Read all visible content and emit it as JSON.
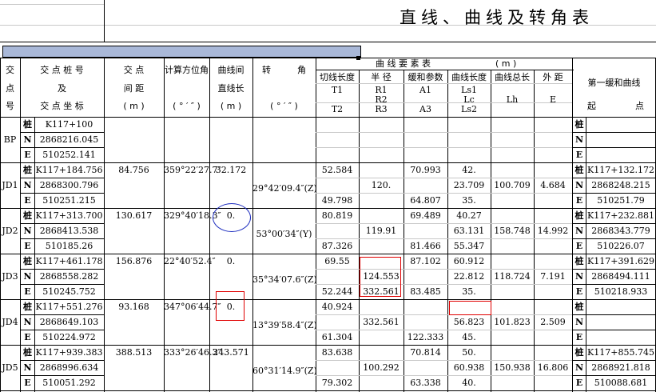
{
  "title": "直线、曲线及转角表",
  "header": {
    "col_jiao": [
      "交",
      "点",
      "号"
    ],
    "col_station": [
      "交 点 桩 号",
      "及",
      "交 点 坐 标"
    ],
    "col_distance": [
      "交 点",
      "间 距",
      "( m )"
    ],
    "col_bearing": [
      "计算方位角",
      "( ° ′ ″ )"
    ],
    "col_between": [
      "曲线间",
      "直线长",
      "( m )"
    ],
    "col_angle": [
      "转",
      "角",
      "( ° ′ ″ )"
    ],
    "curve_group": "曲 线 要 素 表",
    "curve_unit": "( m )",
    "sub_t": [
      "切线长度",
      "T1",
      "T2"
    ],
    "sub_r": [
      "半 径",
      "R1",
      "R2",
      "R3"
    ],
    "sub_a": [
      "缓和参数",
      "A1",
      "A3"
    ],
    "sub_ls": [
      "曲线长度",
      "Ls1",
      "Lc",
      "Ls2"
    ],
    "sub_lh": [
      "曲线总长",
      "Lh"
    ],
    "sub_e": [
      "外 距",
      "E"
    ],
    "right_col": [
      "第一缓和曲线",
      "起",
      "点"
    ]
  },
  "labels": {
    "zhuang": "桩",
    "n": "N",
    "e": "E"
  },
  "rows": [
    {
      "id": "BP",
      "station": "K117+100",
      "n": "2868216.045",
      "e": "510252.141",
      "dist": "",
      "bearing": "",
      "between": "",
      "angle": "",
      "t1": "",
      "r1": "",
      "a1": "",
      "ls1": "",
      "lc": "",
      "lh": "",
      "ext": "",
      "t2": "",
      "r3": "",
      "a3": "",
      "ls2": "",
      "rs": "",
      "rn": "",
      "re": ""
    },
    {
      "id": "JD1",
      "station": "K117+184.756",
      "n": "2868300.796",
      "e": "510251.215",
      "dist": "84.756",
      "bearing": "359°22′27.7″",
      "between": "32.172",
      "angle": "29°42′09.4″(Z)",
      "t1": "52.584",
      "r1": "",
      "a1": "70.993",
      "ls1": "42.",
      "r2": "120.",
      "lc": "23.709",
      "lh": "100.709",
      "ext": "4.684",
      "t2": "49.798",
      "r3": "",
      "a3": "64.807",
      "ls2": "35.",
      "rs": "K117+132.172",
      "rn": "2868248.215",
      "re": "510251.79"
    },
    {
      "id": "JD2",
      "station": "K117+313.700",
      "n": "2868413.538",
      "e": "510185.26",
      "dist": "130.617",
      "bearing": "329°40′18.3″",
      "between": "0.",
      "angle": "53°00′34″(Y)",
      "t1": "80.819",
      "r1": "",
      "a1": "69.489",
      "ls1": "40.27",
      "r2": "119.91",
      "lc": "63.131",
      "lh": "158.748",
      "ext": "14.992",
      "t2": "87.326",
      "r3": "",
      "a3": "81.466",
      "ls2": "55.347",
      "rs": "K117+232.881",
      "rn": "2868343.779",
      "re": "510226.07"
    },
    {
      "id": "JD3",
      "station": "K117+461.178",
      "n": "2868558.282",
      "e": "510245.752",
      "dist": "156.876",
      "bearing": "22°40′52.4″",
      "between": "0.",
      "angle": "35°34′07.6″(Z)",
      "t1": "69.55",
      "r1": "",
      "a1": "87.102",
      "ls1": "60.912",
      "r2": "124.553",
      "lc": "22.812",
      "lh": "118.724",
      "ext": "7.191",
      "t2": "52.244",
      "r3": "332.561",
      "a3": "83.485",
      "ls2": "35.",
      "rs": "K117+391.629",
      "rn": "2868494.111",
      "re": "510218.933"
    },
    {
      "id": "JD4",
      "station": "K117+551.276",
      "n": "2868649.103",
      "e": "510224.972",
      "dist": "93.168",
      "bearing": "347°06′44.7″",
      "between": "0.",
      "angle": "13°39′58.4″(Z)",
      "t1": "40.924",
      "r1": "",
      "a1": "",
      "ls1": "",
      "r2": "332.561",
      "lc": "56.823",
      "lh": "101.823",
      "ext": "2.509",
      "t2": "61.304",
      "r3": "",
      "a3": "122.333",
      "ls2": "45.",
      "rs": "",
      "rn": "",
      "re": ""
    },
    {
      "id": "JD5",
      "station": "K117+939.383",
      "n": "2868996.634",
      "e": "510051.292",
      "dist": "388.513",
      "bearing": "333°26′46.3″",
      "between": "243.571",
      "angle": "60°31′14.9″(Z)",
      "t1": "83.638",
      "r1": "",
      "a1": "70.814",
      "ls1": "50.",
      "r2": "100.292",
      "lc": "60.938",
      "lh": "150.938",
      "ext": "16.806",
      "t2": "79.302",
      "r3": "",
      "a3": "63.338",
      "ls2": "40.",
      "rs": "K117+855.745",
      "rn": "2868921.818",
      "re": "510088.681"
    }
  ]
}
